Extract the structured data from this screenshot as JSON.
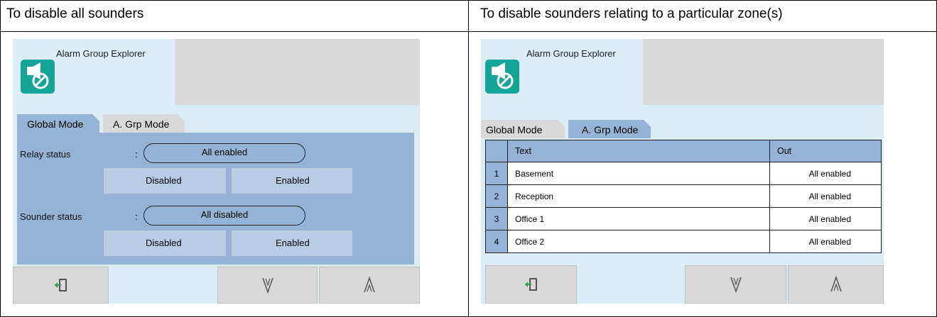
{
  "left": {
    "heading": "To disable all sounders",
    "app_title": "Alarm Group Explorer",
    "tabs": [
      {
        "label": "Global Mode",
        "active": true
      },
      {
        "label": "A. Grp Mode",
        "active": false
      }
    ],
    "relay": {
      "label": "Relay status",
      "colon": ":",
      "value": "All enabled",
      "btn_disabled": "Disabled",
      "btn_enabled": "Enabled"
    },
    "sounder": {
      "label": "Sounder status",
      "colon": ":",
      "value": "All disabled",
      "btn_disabled": "Disabled",
      "btn_enabled": "Enabled"
    }
  },
  "right": {
    "heading": "To disable sounders relating to a particular zone(s)",
    "app_title": "Alarm Group Explorer",
    "tabs": [
      {
        "label": "Global Mode",
        "active": false
      },
      {
        "label": "A. Grp Mode",
        "active": true
      }
    ],
    "table": {
      "headers": [
        "",
        "Text",
        "Out"
      ],
      "rows": [
        {
          "num": "1",
          "text": "Basement",
          "out": "All enabled"
        },
        {
          "num": "2",
          "text": "Reception",
          "out": "All enabled"
        },
        {
          "num": "3",
          "text": "Office 1",
          "out": "All enabled"
        },
        {
          "num": "4",
          "text": "Office 2",
          "out": "All enabled"
        }
      ]
    }
  },
  "icons": {
    "app": "alarm-group-icon",
    "exit": "exit-icon",
    "down": "chevron-down-icon",
    "up": "chevron-up-icon"
  },
  "colors": {
    "teal": "#15a596",
    "panel_bg": "#dbedf4",
    "blue": "#95b3d7",
    "light_blue": "#b8cce4",
    "grey": "#d9d9d9",
    "exit_green": "#2e9e4e"
  }
}
